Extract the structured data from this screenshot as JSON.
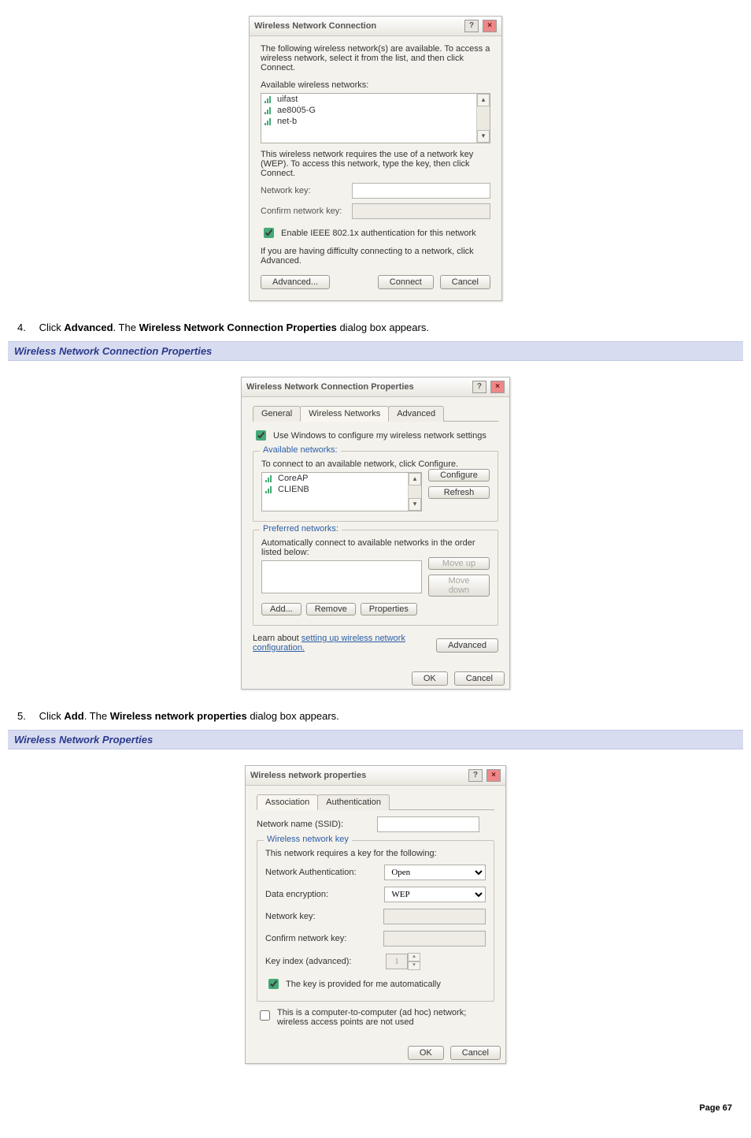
{
  "dlg1": {
    "title": "Wireless Network Connection",
    "intro": "The following wireless network(s) are available. To access a wireless network, select it from the list, and then click Connect.",
    "avail_label": "Available wireless networks:",
    "networks": [
      "uifast",
      "ae8005-G",
      "net-b"
    ],
    "wep_note": "This wireless network requires the use of a network key (WEP). To access this network, type the key, then click Connect.",
    "net_key_label": "Network key:",
    "confirm_key_label": "Confirm network key:",
    "enable_8021x": "Enable IEEE 802.1x authentication for this network",
    "advanced_note": "If you are having difficulty connecting to a network, click Advanced.",
    "btn_advanced": "Advanced...",
    "btn_connect": "Connect",
    "btn_cancel": "Cancel"
  },
  "step4": "Click Advanced. The Wireless Network Connection Properties dialog box appears.",
  "step4_plain_pre": "Click ",
  "step4_bold1": "Advanced",
  "step4_mid": ". The ",
  "step4_bold2": "Wireless Network Connection Properties",
  "step4_post": " dialog box appears.",
  "banner2": "Wireless Network Connection Properties",
  "dlg2": {
    "title": "Wireless Network Connection Properties",
    "tab_general": "General",
    "tab_wn": "Wireless Networks",
    "tab_adv": "Advanced",
    "use_windows": "Use Windows to configure my wireless network settings",
    "avail_legend": "Available networks:",
    "avail_hint": "To connect to an available network, click Configure.",
    "avail_items": [
      "CoreAP",
      "CLIENB"
    ],
    "btn_configure": "Configure",
    "btn_refresh": "Refresh",
    "pref_legend": "Preferred networks:",
    "pref_hint": "Automatically connect to available networks in the order listed below:",
    "btn_moveup": "Move up",
    "btn_movedown": "Move down",
    "btn_add": "Add...",
    "btn_remove": "Remove",
    "btn_properties": "Properties",
    "learn_pre": "Learn about ",
    "learn_link": "setting up wireless network configuration.",
    "btn_advanced": "Advanced",
    "btn_ok": "OK",
    "btn_cancel": "Cancel"
  },
  "step5_pre": "Click ",
  "step5_bold1": "Add",
  "step5_mid": ". The ",
  "step5_bold2": "Wireless network properties",
  "step5_post": " dialog box appears.",
  "banner3": "Wireless Network Properties",
  "dlg3": {
    "title": "Wireless network properties",
    "tab_assoc": "Association",
    "tab_auth": "Authentication",
    "ssid_label": "Network name (SSID):",
    "wnk_legend": "Wireless network key",
    "req_note": "This network requires a key for the following:",
    "netauth_label": "Network Authentication:",
    "netauth_val": "Open",
    "dataenc_label": "Data encryption:",
    "dataenc_val": "WEP",
    "netkey_label": "Network key:",
    "confkey_label": "Confirm network key:",
    "keyidx_label": "Key index (advanced):",
    "keyidx_val": "1",
    "key_auto": "The key is provided for me automatically",
    "adhoc": "This is a computer-to-computer (ad hoc) network; wireless access points are not used",
    "btn_ok": "OK",
    "btn_cancel": "Cancel"
  },
  "footer": "Page 67"
}
